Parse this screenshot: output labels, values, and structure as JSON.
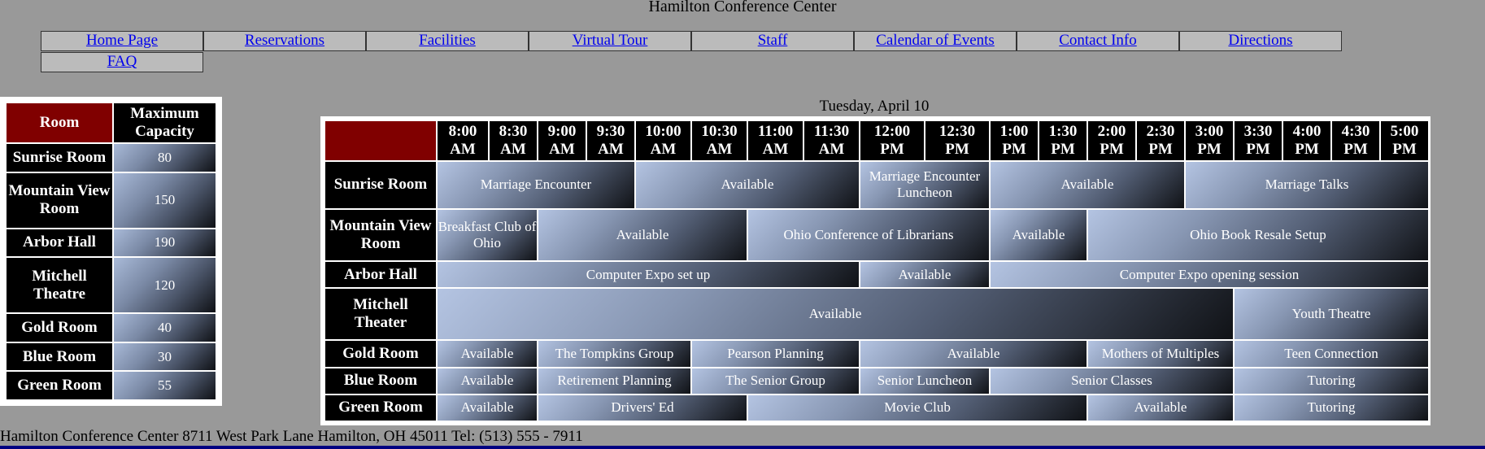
{
  "site_title": "Hamilton Conference Center",
  "nav": [
    "Home Page",
    "Reservations",
    "Facilities",
    "Virtual Tour",
    "Staff",
    "Calendar of Events",
    "Contact Info",
    "Directions",
    "FAQ"
  ],
  "capacity": {
    "headers": [
      "Room",
      "Maximum Capacity"
    ],
    "rows": [
      {
        "room": "Sunrise Room",
        "capacity": "80"
      },
      {
        "room": "Mountain View Room",
        "capacity": "150"
      },
      {
        "room": "Arbor Hall",
        "capacity": "190"
      },
      {
        "room": "Mitchell Theatre",
        "capacity": "120"
      },
      {
        "room": "Gold Room",
        "capacity": "40"
      },
      {
        "room": "Blue Room",
        "capacity": "30"
      },
      {
        "room": "Green Room",
        "capacity": "55"
      }
    ]
  },
  "schedule": {
    "date": "Tuesday, April 10",
    "times": [
      "8:00 AM",
      "8:30 AM",
      "9:00 AM",
      "9:30 AM",
      "10:00 AM",
      "10:30 AM",
      "11:00 AM",
      "11:30 AM",
      "12:00 PM",
      "12:30 PM",
      "1:00 PM",
      "1:30 PM",
      "2:00 PM",
      "2:30 PM",
      "3:00 PM",
      "3:30 PM",
      "4:00 PM",
      "4:30 PM",
      "5:00 PM"
    ],
    "rows": [
      {
        "room": "Sunrise Room",
        "events": [
          {
            "label": "Marriage Encounter",
            "span": 4
          },
          {
            "label": "Available",
            "span": 4
          },
          {
            "label": "Marriage Encounter Luncheon",
            "span": 2
          },
          {
            "label": "Available",
            "span": 4
          },
          {
            "label": "Marriage Talks",
            "span": 5
          }
        ]
      },
      {
        "room": "Mountain View Room",
        "events": [
          {
            "label": "Breakfast Club of Ohio",
            "span": 2
          },
          {
            "label": "Available",
            "span": 4
          },
          {
            "label": "Ohio Conference of Librarians",
            "span": 4
          },
          {
            "label": "Available",
            "span": 2
          },
          {
            "label": "Ohio Book Resale Setup",
            "span": 7
          }
        ]
      },
      {
        "room": "Arbor Hall",
        "events": [
          {
            "label": "Computer Expo set up",
            "span": 8
          },
          {
            "label": "Available",
            "span": 2
          },
          {
            "label": "Computer Expo opening session",
            "span": 9
          }
        ]
      },
      {
        "room": "Mitchell Theater",
        "events": [
          {
            "label": "Available",
            "span": 15
          },
          {
            "label": "Youth Theatre",
            "span": 4
          }
        ]
      },
      {
        "room": "Gold Room",
        "events": [
          {
            "label": "Available",
            "span": 2
          },
          {
            "label": "The Tompkins Group",
            "span": 3
          },
          {
            "label": "Pearson Planning",
            "span": 3
          },
          {
            "label": "Available",
            "span": 4
          },
          {
            "label": "Mothers of Multiples",
            "span": 3
          },
          {
            "label": "Teen Connection",
            "span": 4
          }
        ]
      },
      {
        "room": "Blue Room",
        "events": [
          {
            "label": "Available",
            "span": 2
          },
          {
            "label": "Retirement Planning",
            "span": 3
          },
          {
            "label": "The Senior Group",
            "span": 3
          },
          {
            "label": "Senior Luncheon",
            "span": 2
          },
          {
            "label": "Senior Classes",
            "span": 5
          },
          {
            "label": "Tutoring",
            "span": 4
          }
        ]
      },
      {
        "room": "Green Room",
        "events": [
          {
            "label": "Available",
            "span": 2
          },
          {
            "label": "Drivers' Ed",
            "span": 4
          },
          {
            "label": "Movie Club",
            "span": 6
          },
          {
            "label": "Available",
            "span": 3
          },
          {
            "label": "Tutoring",
            "span": 4
          }
        ]
      }
    ]
  },
  "footer": "Hamilton Conference Center 8711 West Park Lane Hamilton, OH 45011 Tel: (513) 555 - 7911",
  "colors": {
    "header_red": "#800000",
    "page_bg": "#999999",
    "link": "#0000ee",
    "bottom_bar": "#000080"
  }
}
